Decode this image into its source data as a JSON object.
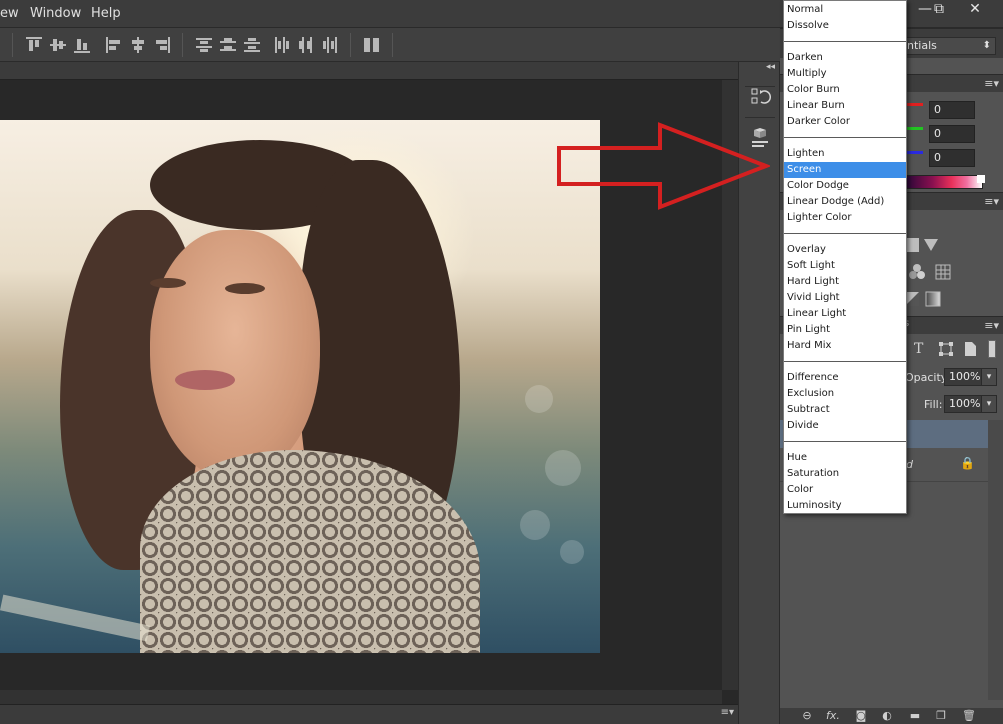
{
  "menubar": {
    "items": [
      "ew",
      "Window",
      "Help"
    ]
  },
  "window_controls": {
    "minimize": "—",
    "restore": "⧉",
    "close": "✕"
  },
  "workspace": {
    "value": "ntials"
  },
  "color_panel": {
    "r": "0",
    "g": "0",
    "b": "0",
    "colors": {
      "r": "#e22020",
      "g": "#22c422",
      "b": "#2a2ae0"
    }
  },
  "layers_panel": {
    "opacity_label": "Opacity:",
    "opacity_value": "100%",
    "fill_label": "Fill:",
    "fill_value": "100%",
    "type_icon_text": "T",
    "layer_name_partial": "d"
  },
  "blend_modes": {
    "groups": [
      [
        "Normal",
        "Dissolve"
      ],
      [
        "Darken",
        "Multiply",
        "Color Burn",
        "Linear Burn",
        "Darker Color"
      ],
      [
        "Lighten",
        "Screen",
        "Color Dodge",
        "Linear Dodge (Add)",
        "Lighter Color"
      ],
      [
        "Overlay",
        "Soft Light",
        "Hard Light",
        "Vivid Light",
        "Linear Light",
        "Pin Light",
        "Hard Mix"
      ],
      [
        "Difference",
        "Exclusion",
        "Subtract",
        "Divide"
      ],
      [
        "Hue",
        "Saturation",
        "Color",
        "Luminosity"
      ]
    ],
    "selected": "Screen",
    "highlight_color": "#3d8ee8"
  },
  "annotation": {
    "arrow_color": "#d42020"
  },
  "bottom_icons": [
    "link-icon",
    "fx-icon",
    "mask-icon",
    "adjustment-icon",
    "folder-icon",
    "new-layer-icon",
    "trash-icon"
  ],
  "bottom_labels": {
    "fx": "fx."
  }
}
